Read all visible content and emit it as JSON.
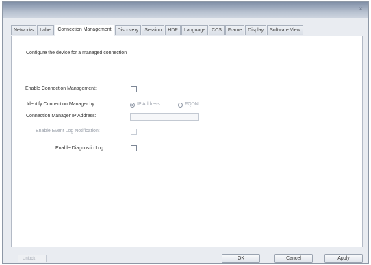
{
  "window": {
    "title": "",
    "close_glyph": "×"
  },
  "tabs": [
    {
      "label": "Networks",
      "active": false
    },
    {
      "label": "Label",
      "active": false
    },
    {
      "label": "Connection Management",
      "active": true
    },
    {
      "label": "Discovery",
      "active": false
    },
    {
      "label": "Session",
      "active": false
    },
    {
      "label": "HDP",
      "active": false
    },
    {
      "label": "Language",
      "active": false
    },
    {
      "label": "CCS",
      "active": false
    },
    {
      "label": "Frame",
      "active": false
    },
    {
      "label": "Display",
      "active": false
    },
    {
      "label": "Software View",
      "active": false
    }
  ],
  "panel": {
    "description": "Configure the device for a managed connection",
    "enable_cm_label": "Enable Connection Management:",
    "enable_cm_checked": false,
    "identify_label": "Identify Connection Manager by:",
    "identify_options": [
      {
        "label": "IP Address",
        "selected": true
      },
      {
        "label": "FQDN",
        "selected": false
      }
    ],
    "ip_label": "Connection Manager IP Address:",
    "ip_value": "",
    "event_log_label": "Enable Event Log Notification:",
    "event_log_checked": false,
    "diag_label": "Enable Diagnostic Log:",
    "diag_checked": false
  },
  "footer": {
    "status": "Unlock",
    "ok": "OK",
    "cancel": "Cancel",
    "apply": "Apply"
  }
}
